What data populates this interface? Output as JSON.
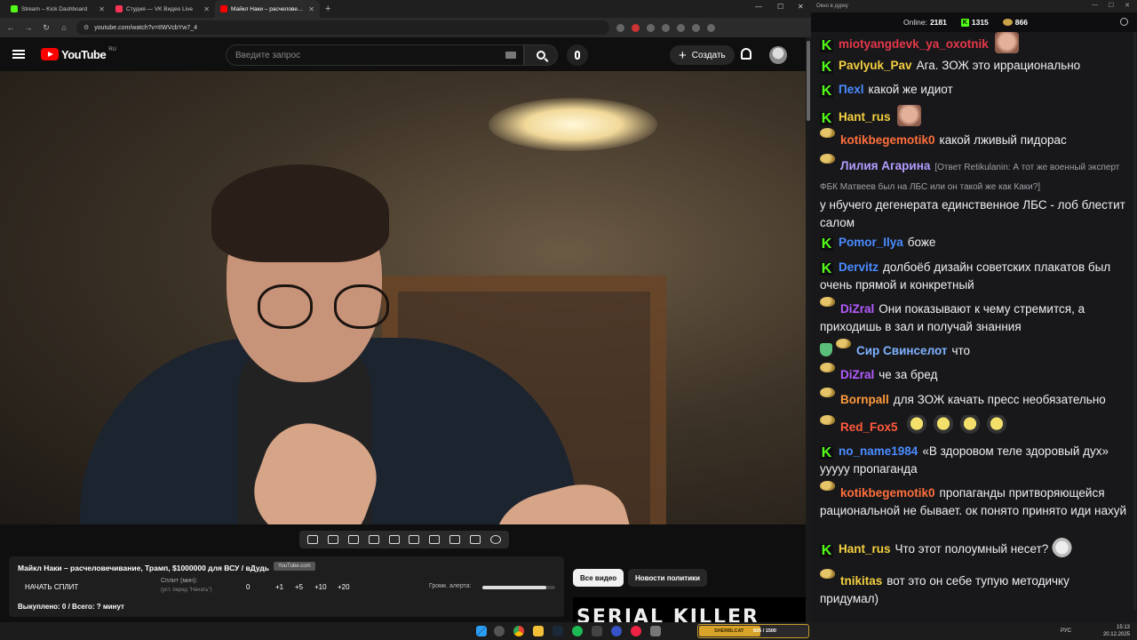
{
  "browser": {
    "tabs": [
      {
        "title": "Stream – Kick Dashboard",
        "color": "#53fc18"
      },
      {
        "title": "Студия — VK Видео Live",
        "color": "#ff3355"
      },
      {
        "title": "Майкл Наки – расчеловеч...",
        "color": "#ff0000"
      }
    ],
    "url": "youtube.com/watch?v=tIWVcbYw7_4"
  },
  "youtube": {
    "logo_text": "YouTube",
    "country_code": "RU",
    "search_placeholder": "Введите запрос",
    "create_label": "Создать"
  },
  "panel": {
    "title": "Майкл Наки – расчеловечивание, Трамп, $1000000 для ВСУ / вДудь",
    "title_tag": "YouTube.com",
    "split_button": "НАЧАТЬ СПЛИТ",
    "split_label": "Сплит (мин):",
    "split_hint": "(уст. перед \"Начать\")",
    "split_options": [
      "0",
      "+1",
      "+5",
      "+10",
      "+20"
    ],
    "alert_label": "Громк. алерта:",
    "alert_volume": 0.88,
    "paid_status": "Выкуплено: 0 / Всего: ? минут"
  },
  "chips": {
    "all": "Все видео",
    "politics": "Новости политики"
  },
  "thumbnail_text": "SERIAL KILLER",
  "chat": {
    "window_title": "Окно в дурку",
    "online_label": "Online:",
    "online_count": "2181",
    "kick_count": "1315",
    "potato_count": "866",
    "messages": [
      {
        "badge": "k",
        "nick": "miotyangdevk_ya_oxotnik",
        "color": "#e6384a",
        "text": "",
        "emote": "face"
      },
      {
        "badge": "k",
        "nick": "Pavlyuk_Pav",
        "color": "#f4d03f",
        "text": "Ага. ЗОЖ это иррационально"
      },
      {
        "badge": "k",
        "nick": "Пexl",
        "color": "#4a8cff",
        "text": "какой же идиот"
      },
      {
        "badge": "k",
        "nick": "Hant_rus",
        "color": "#f4d03f",
        "text": "",
        "emote": "face"
      },
      {
        "badge": "p",
        "nick": "kotikbegemotik0",
        "color": "#ff6f3c",
        "text": "какой лживый пидорас"
      },
      {
        "badge": "p",
        "nick": "Лилия Агарина",
        "color": "#b39dff",
        "reply": "[Ответ Retikulanin: А тот же военный эксперт ФБК Матвеев был на ЛБС или он такой же как Каки?]",
        "text": "у нбучего дегенерата единственное ЛБС - лоб блестит салом"
      },
      {
        "badge": "k",
        "nick": "Pomor_Ilya",
        "color": "#4a8cff",
        "text": "боже"
      },
      {
        "badge": "k",
        "nick": "Dervitz",
        "color": "#4a8cff",
        "text": "долбоёб дизайн советских плакатов был очень прямой и конкретный"
      },
      {
        "badge": "p",
        "nick": "DiZral",
        "color": "#b45cff",
        "text": "Они показывают к чему стремится, а приходишь в зал и получай знанния"
      },
      {
        "badge": "s",
        "nick": "Сир Свинселот",
        "color": "#7fb2ff",
        "text": "что"
      },
      {
        "badge": "p",
        "nick": "DiZral",
        "color": "#b45cff",
        "text": "че за бред"
      },
      {
        "badge": "p",
        "nick": "Bornpall",
        "color": "#ff9a3c",
        "text": "для ЗОЖ качать пресс необязательно"
      },
      {
        "badge": "p",
        "nick": "Red_Fox5",
        "color": "#ff5a3c",
        "text": "",
        "emote": "pepe4"
      },
      {
        "badge": "k",
        "nick": "no_name1984",
        "color": "#4a8cff",
        "text": "«В здоровом теле здоровый дух» ууууу пропаганда"
      },
      {
        "badge": "p",
        "nick": "kotikbegemotik0",
        "color": "#ff6f3c",
        "text": "пропаганды притворяющейся рациональной не бывает. ок понято принято иди нахуй"
      },
      {
        "badge": "k",
        "nick": "Hant_rus",
        "color": "#f4d03f",
        "text": "Что этот полоумный несет?",
        "emote": "cat"
      },
      {
        "badge": "p",
        "nick": "tnikitas",
        "color": "#f4d03f",
        "text": "вот это он себе тупую методичку придумал)"
      }
    ]
  },
  "taskbar": {
    "widget_name": "SHERBLCAT",
    "widget_progress": "835 / 1500",
    "widget_fraction": 0.557,
    "lang": "РУС",
    "time": "15:13",
    "date": "20.12.2025"
  }
}
